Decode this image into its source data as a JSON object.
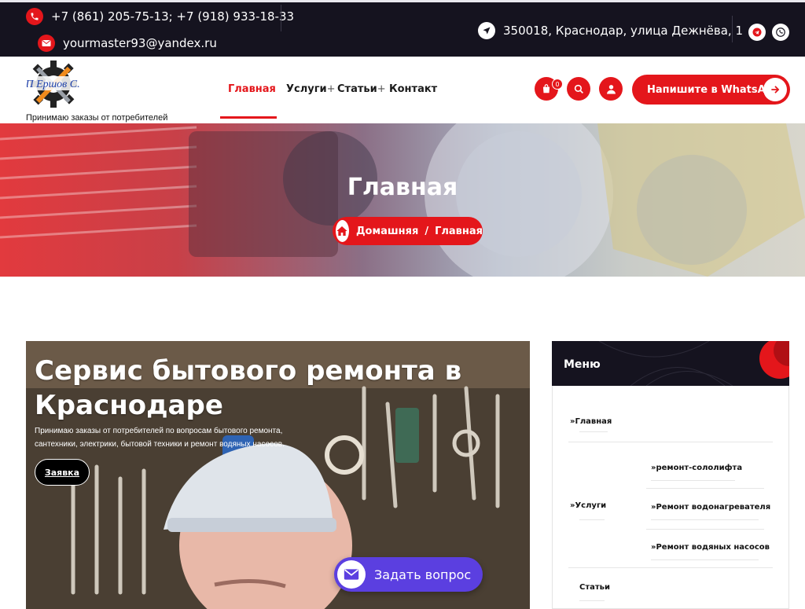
{
  "topbar": {
    "phones": "+7 (861) 205-75-13; +7 (918) 933-18-33",
    "email": "yourmaster93@yandex.ru",
    "address": "350018, Краснодар, улица Дежнёва, 1"
  },
  "header": {
    "logo_text": "ИП Ершов С.В.",
    "tagline": "Принимаю заказы от потребителей",
    "nav": [
      {
        "label": "Главная"
      },
      {
        "label": "Услуги"
      },
      {
        "label": "Статьи"
      },
      {
        "label": "Контакт"
      }
    ],
    "nav_plus": "+",
    "cart_count": "0",
    "whatsapp_label": "Напишите в WhatsApp"
  },
  "hero": {
    "title": "Главная",
    "breadcrumb_home": "Домашняя",
    "breadcrumb_sep": "/",
    "breadcrumb_current": "Главная"
  },
  "main": {
    "title": "Сервис бытового ремонта в Краснодаре",
    "text": "Принимаю заказы от потребителей по вопросам бытового ремонта, сантехники, электрики, бытовой техники и ремонт водяных насосов.",
    "button": "Заявка",
    "ask_button": "Задать вопрос"
  },
  "sidebar": {
    "title": "Меню",
    "chevron": "»",
    "items": {
      "home": "Главная",
      "services": "Услуги",
      "sub1": "ремонт-сололифта",
      "sub2": "Ремонт водонагревателя",
      "sub3": "Ремонт водяных насосов",
      "articles": "Статьи"
    }
  },
  "colors": {
    "accent": "#e4161b",
    "dark": "#15131f",
    "chat": "#5b3fe0"
  }
}
